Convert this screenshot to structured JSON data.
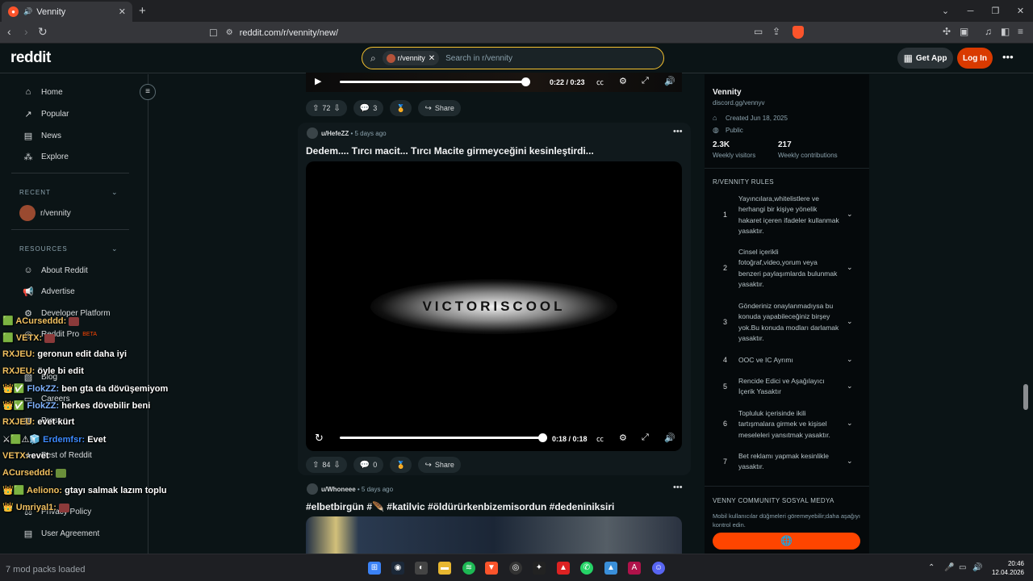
{
  "browser": {
    "tab_title": "Vennity",
    "url": "reddit.com/r/vennity/new/"
  },
  "header": {
    "logo": "reddit",
    "search_chip": "r/vennity",
    "search_placeholder": "Search in r/vennity",
    "get_app": "Get App",
    "login": "Log In"
  },
  "leftnav": {
    "items": [
      "Home",
      "Popular",
      "News",
      "Explore"
    ],
    "recent_heading": "RECENT",
    "recent_item": "r/vennity",
    "resources_heading": "RESOURCES",
    "resources": [
      "About Reddit",
      "Advertise",
      "Developer Platform",
      "Reddit Pro",
      "Blog",
      "Careers",
      "Press",
      "Best of Reddit",
      "Privacy Policy",
      "User Agreement"
    ],
    "beta": "BETA"
  },
  "top_player": {
    "time": "0:22 / 0:23"
  },
  "post1_actions": {
    "votes": "72",
    "comments": "3",
    "share": "Share"
  },
  "post2": {
    "user": "u/HefeZZ",
    "age": "5 days ago",
    "title": "Dedem.... Tırcı macit... Tırcı Macite girmeyceğini kesinleştirdi...",
    "video_text": "VICTORISCOOL",
    "time": "0:18 / 0:18",
    "votes": "84",
    "comments": "0",
    "share": "Share"
  },
  "post3": {
    "user": "u/Whoneee",
    "age": "5 days ago",
    "title": "#elbetbirgün #🪶 #katilvic #öldürürkenbizemisordun #dedeniniksiri"
  },
  "community": {
    "name": "Vennity",
    "sub": "discord.gg/vennyv",
    "created": "Created Jun 18, 2025",
    "visibility": "Public",
    "visitors_num": "2.3K",
    "visitors_lbl": "Weekly visitors",
    "contrib_num": "217",
    "contrib_lbl": "Weekly contributions",
    "rules_heading": "R/VENNITY RULES",
    "rules": [
      {
        "n": "1",
        "text": "Yayıncılara,whitelistlere ve herhangi bir kişiye yönelik hakaret içeren ifadeler kullanmak yasaktır."
      },
      {
        "n": "2",
        "text": "Cinsel içerikli fotoğraf,video,yorum veya benzeri paylaşımlarda bulunmak yasaktır."
      },
      {
        "n": "3",
        "text": "Gönderiniz onaylanmadıysa bu konuda yapabileceğiniz birşey yok.Bu konuda modları darlamak yasaktır."
      },
      {
        "n": "4",
        "text": "OOC ve IC Ayrımı"
      },
      {
        "n": "5",
        "text": "Rencide Edici ve Aşağılayıcı İçerik Yasaktır"
      },
      {
        "n": "6",
        "text": "Topluluk içerisinde ikili tartışmalara girmek ve kişisel meseleleri yansıtmak yasaktır."
      },
      {
        "n": "7",
        "text": "Bet reklamı yapmak kesinlikle yasaktır."
      }
    ],
    "social_heading": "VENNY COMMUNITY SOSYAL MEDYA",
    "social_note": "Mobil kullanıcılar düğmeleri göremeyebilir;daha aşağıyı kontrol edin."
  },
  "chat": [
    {
      "user": "ACurseddd:",
      "msg": "",
      "color": "#f0c060",
      "emote": true
    },
    {
      "user": "VETX:",
      "msg": "",
      "color": "#f0c060",
      "emote": true
    },
    {
      "user": "RXJEU:",
      "msg": "geronun edit daha iyi",
      "color": "#f0c060"
    },
    {
      "user": "RXJEU:",
      "msg": "öyle bi edit",
      "color": "#f0c060"
    },
    {
      "user": "FlokZZ:",
      "msg": "ben gta da dövüşemiyom",
      "color": "#7fb3ff"
    },
    {
      "user": "FlokZZ:",
      "msg": "herkes dövebilir beni",
      "color": "#7fb3ff"
    },
    {
      "user": "RXJEU:",
      "msg": "evet kürt",
      "color": "#f0c060"
    },
    {
      "user": "Erdemfsr:",
      "msg": "Evet",
      "color": "#3d8bff"
    },
    {
      "user": "VETX:",
      "msg": "evet",
      "color": "#f0c060"
    },
    {
      "user": "ACurseddd:",
      "msg": "",
      "color": "#f0c060",
      "emote2": true
    },
    {
      "user": "Aeliono:",
      "msg": "gtayı salmak lazım toplu",
      "color": "#f0c060"
    },
    {
      "user": "Umriyal1:",
      "msg": "",
      "color": "#f0c060",
      "emote": true
    }
  ],
  "taskbar": {
    "mod_text": "7 mod packs loaded",
    "time": "20:46",
    "date": "12.04.2026"
  }
}
